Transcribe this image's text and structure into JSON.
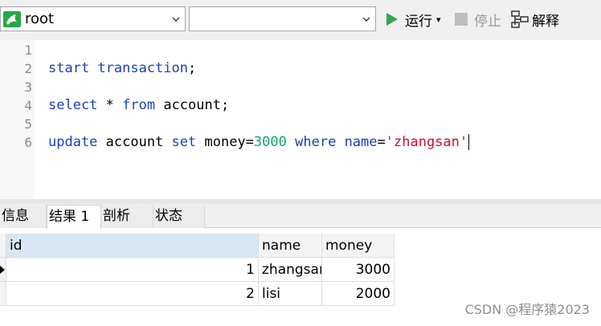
{
  "toolbar": {
    "connection": "root",
    "database": "",
    "run_label": "运行",
    "run_dropdown": "▾",
    "stop_label": "停止",
    "explain_label": "解释"
  },
  "editor": {
    "line_numbers": [
      "1",
      "2",
      "3",
      "4",
      "5",
      "6"
    ]
  },
  "tabs": [
    "信息",
    "结果 1",
    "剖析",
    "状态"
  ],
  "grid": {
    "columns": [
      "id",
      "name",
      "money"
    ],
    "rows": [
      [
        "1",
        "zhangsan",
        "3000"
      ],
      [
        "2",
        "lisi",
        "2000"
      ]
    ]
  },
  "watermark": "CSDN @程序猿2023",
  "colors": {
    "keyword": "#1a3fb3",
    "number": "#14a36a",
    "string": "#c8102e",
    "run": "#2fa84f"
  }
}
